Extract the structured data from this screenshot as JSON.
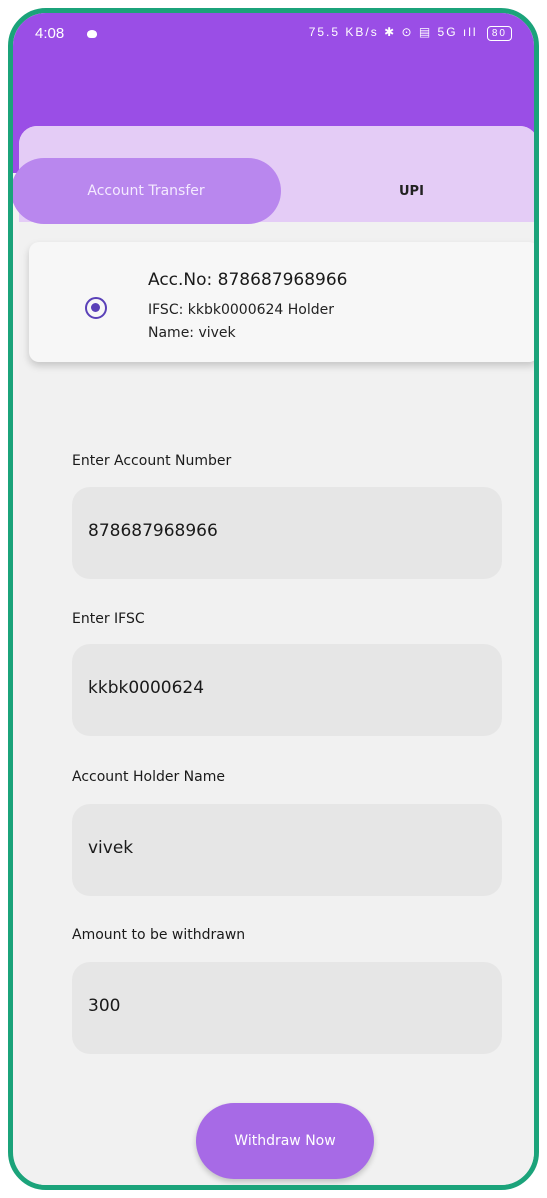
{
  "status_bar": {
    "time": "4:08",
    "icons_text": "75.5 KB/s ✱ ⊙ ▤ 5G ıll",
    "battery": "80"
  },
  "tabs": [
    {
      "label": "Account Transfer",
      "active": true
    },
    {
      "label": "UPI",
      "active": false
    }
  ],
  "saved_account": {
    "acc_no": "Acc.No: 878687968966",
    "ifsc_holder": "IFSC: kkbk0000624 Holder",
    "name": "Name: vivek",
    "selected": true
  },
  "form": {
    "account_number": {
      "label": "Enter Account Number",
      "value": "878687968966"
    },
    "ifsc": {
      "label": "Enter IFSC",
      "value": "kkbk0000624"
    },
    "holder_name": {
      "label": "Account Holder Name",
      "value": "vivek"
    },
    "amount": {
      "label": "Amount to be withdrawn",
      "value": "300"
    }
  },
  "withdraw_button": "Withdraw Now",
  "colors": {
    "header": "#9a4ee6",
    "tab_strip": "#e4ccf6",
    "tab_active": "#b987ee",
    "button": "#a76ae6",
    "frame_border": "#1ba37a",
    "radio": "#5a41b8"
  }
}
